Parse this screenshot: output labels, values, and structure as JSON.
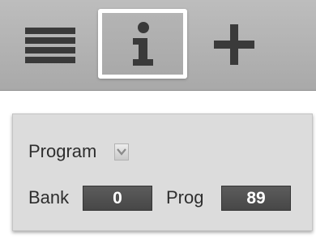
{
  "toolbar": {
    "buttons": [
      {
        "icon": "list-icon",
        "selected": false
      },
      {
        "icon": "info-icon",
        "selected": true
      },
      {
        "icon": "plus-icon",
        "selected": false
      }
    ]
  },
  "panel": {
    "program_label": "Program",
    "program_dropdown_icon": "chevron-down-icon",
    "bank_label": "Bank",
    "bank_value": "0",
    "prog_label": "Prog",
    "prog_value": "89"
  },
  "colors": {
    "toolbar_bg": "#b3b3b3",
    "icon": "#3a3a3a",
    "selected_border": "#ffffff",
    "panel_bg": "#dcdcdc",
    "value_box_bg": "#515151",
    "value_text": "#ffffff"
  }
}
